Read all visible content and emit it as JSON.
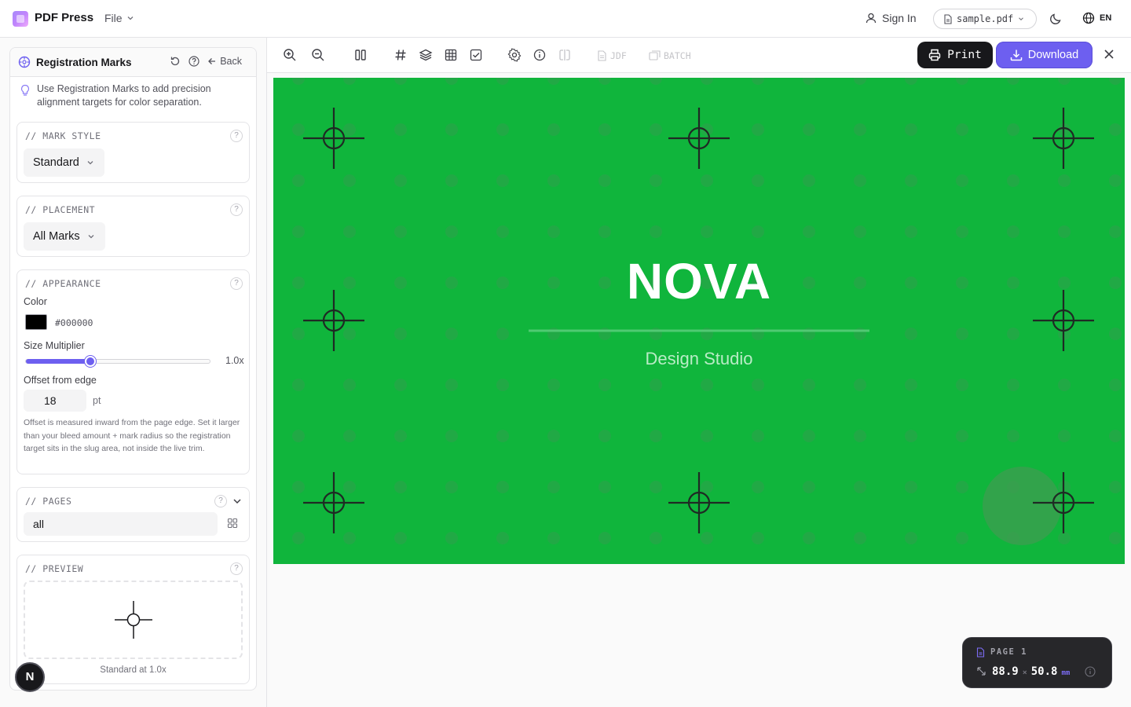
{
  "app": {
    "name": "PDF Press",
    "file_menu": "File"
  },
  "header": {
    "sign_in": "Sign In",
    "file_name": "sample.pdf",
    "language": "EN"
  },
  "panel": {
    "title": "Registration Marks",
    "back_label": "Back",
    "tip": "Use Registration Marks to add precision alignment targets for color separation.",
    "mark_style": {
      "label": "// MARK STYLE",
      "value": "Standard"
    },
    "placement": {
      "label": "// PLACEMENT",
      "value": "All Marks"
    },
    "appearance": {
      "label": "// APPEARANCE",
      "color_label": "Color",
      "color_hex": "#000000",
      "size_label": "Size Multiplier",
      "size_value": "1.0x",
      "size_fraction": 0.35,
      "offset_label": "Offset from edge",
      "offset_value": "18",
      "offset_unit": "pt",
      "offset_note": "Offset is measured inward from the page edge. Set it larger than your bleed amount + mark radius so the registration target sits in the slug area, not inside the live trim."
    },
    "pages": {
      "label": "// PAGES",
      "value": "all"
    },
    "preview": {
      "label": "// PREVIEW",
      "caption": "Standard at 1.0x"
    }
  },
  "toolbar": {
    "jdf_label": "JDF",
    "batch_label": "BATCH",
    "print_label": "Print",
    "download_label": "Download"
  },
  "document": {
    "title": "NOVA",
    "subtitle": "Design Studio",
    "background": "#10b53c"
  },
  "page_info": {
    "label": "PAGE 1",
    "width": "88.9",
    "times": "×",
    "height": "50.8",
    "unit": "mm"
  },
  "colors": {
    "accent": "#6d5ff0",
    "dark": "#18181b"
  },
  "badge": {
    "letter": "N"
  }
}
